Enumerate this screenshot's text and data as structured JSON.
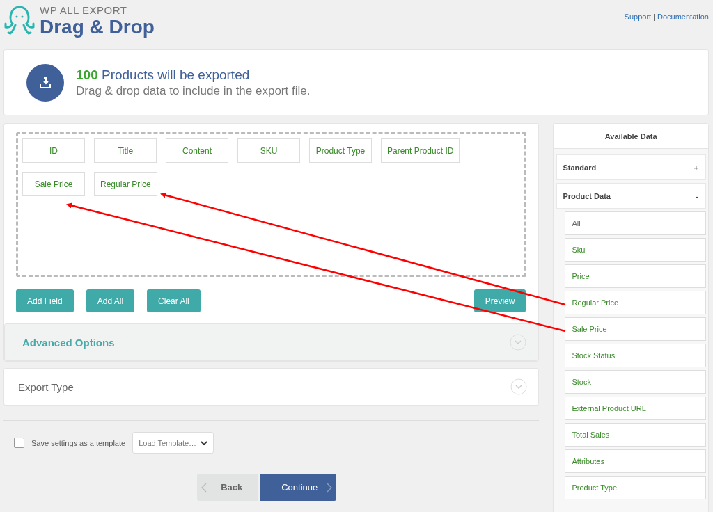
{
  "header": {
    "brand": "WP ALL EXPORT",
    "title": "Drag & Drop",
    "links": [
      "Support",
      "Documentation"
    ],
    "separator": "|"
  },
  "summary": {
    "count": "100",
    "headline": "Products will be exported",
    "subtitle": "Drag & drop data to include in the export file."
  },
  "fields": [
    "ID",
    "Title",
    "Content",
    "SKU",
    "Product Type",
    "Parent Product ID",
    "Sale Price",
    "Regular Price"
  ],
  "buttons": [
    "Add Field",
    "Add All",
    "Clear All"
  ],
  "preview": "Preview",
  "sections": [
    {
      "title": "Advanced Options",
      "kind": "active"
    },
    {
      "title": "Export Type",
      "kind": "plain"
    }
  ],
  "template": {
    "checked": false,
    "label": "Save settings as a template",
    "select": "Load Template…"
  },
  "nav": {
    "back": "Back",
    "continue": "Continue"
  },
  "available": {
    "title": "Available Data",
    "groups": [
      {
        "label": "Standard",
        "toggle": "+"
      },
      {
        "label": "Product Data",
        "toggle": "-",
        "items": [
          {
            "label": "All",
            "kind": "all"
          },
          {
            "label": "Sku",
            "kind": "field"
          },
          {
            "label": "Price",
            "kind": "field"
          },
          {
            "label": "Regular Price",
            "kind": "field"
          },
          {
            "label": "Sale Price",
            "kind": "field"
          },
          {
            "label": "Stock Status",
            "kind": "field"
          },
          {
            "label": "Stock",
            "kind": "field"
          },
          {
            "label": "External Product URL",
            "kind": "field"
          },
          {
            "label": "Total Sales",
            "kind": "field"
          },
          {
            "label": "Attributes",
            "kind": "field"
          },
          {
            "label": "Product Type",
            "kind": "field"
          }
        ]
      }
    ]
  }
}
